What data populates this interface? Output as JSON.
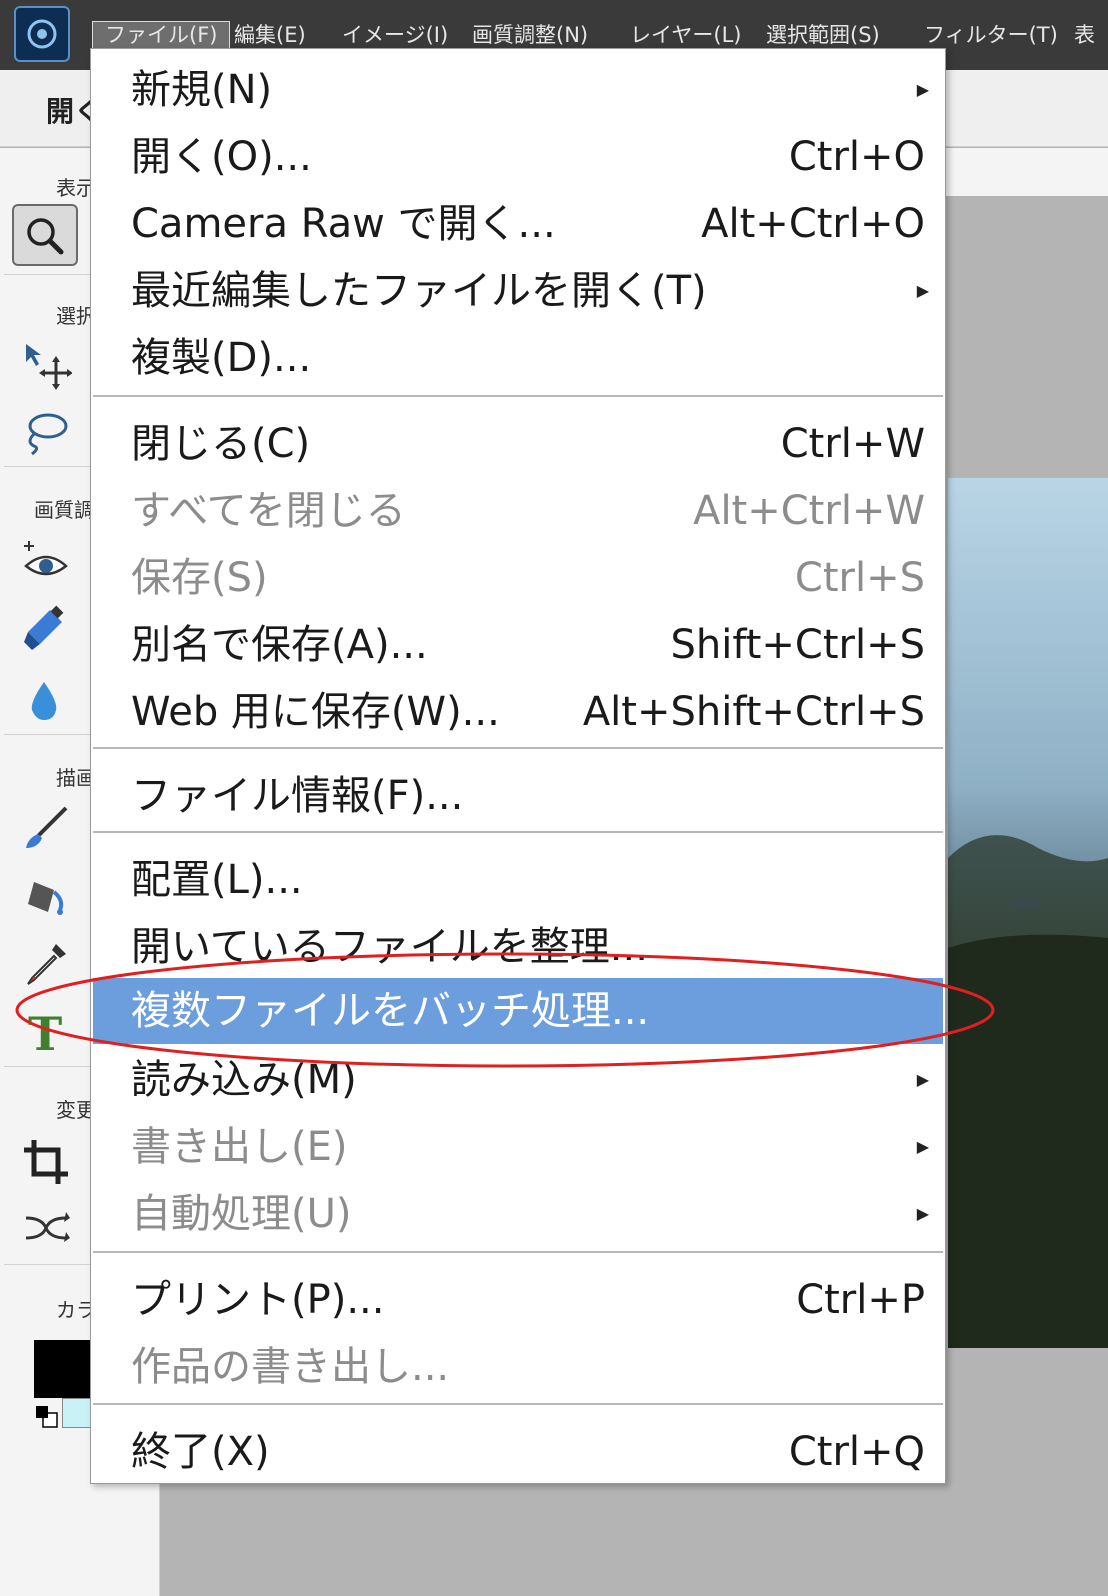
{
  "menubar": {
    "items": [
      {
        "label": "ファイル(F)"
      },
      {
        "label": "編集(E)"
      },
      {
        "label": "イメージ(I)"
      },
      {
        "label": "画質調整(N)"
      },
      {
        "label": "レイヤー(L)"
      },
      {
        "label": "選択範囲(S)"
      },
      {
        "label": "フィルター(T)"
      },
      {
        "label": "表"
      }
    ]
  },
  "options": {
    "label": "開く"
  },
  "toolpanel": {
    "sections": [
      {
        "label": "表示"
      },
      {
        "label": "選択"
      },
      {
        "label": "画質調整"
      },
      {
        "label": "描画"
      },
      {
        "label": "変更"
      },
      {
        "label": "カラー"
      }
    ]
  },
  "file_menu": {
    "items": [
      {
        "label": "新規(N)",
        "shortcut": "",
        "submenu": true,
        "disabled": false
      },
      {
        "label": "開く(O)...",
        "shortcut": "Ctrl+O",
        "submenu": false,
        "disabled": false
      },
      {
        "label": "Camera Raw で開く...",
        "shortcut": "Alt+Ctrl+O",
        "submenu": false,
        "disabled": false
      },
      {
        "label": "最近編集したファイルを開く(T)",
        "shortcut": "",
        "submenu": true,
        "disabled": false
      },
      {
        "label": "複製(D)...",
        "shortcut": "",
        "submenu": false,
        "disabled": false
      },
      {
        "label": "閉じる(C)",
        "shortcut": "Ctrl+W",
        "submenu": false,
        "disabled": false
      },
      {
        "label": "すべてを閉じる",
        "shortcut": "Alt+Ctrl+W",
        "submenu": false,
        "disabled": true
      },
      {
        "label": "保存(S)",
        "shortcut": "Ctrl+S",
        "submenu": false,
        "disabled": true
      },
      {
        "label": "別名で保存(A)...",
        "shortcut": "Shift+Ctrl+S",
        "submenu": false,
        "disabled": false
      },
      {
        "label": "Web 用に保存(W)...",
        "shortcut": "Alt+Shift+Ctrl+S",
        "submenu": false,
        "disabled": false
      },
      {
        "label": "ファイル情報(F)...",
        "shortcut": "",
        "submenu": false,
        "disabled": false
      },
      {
        "label": "配置(L)...",
        "shortcut": "",
        "submenu": false,
        "disabled": false
      },
      {
        "label": "開いているファイルを整理...",
        "shortcut": "",
        "submenu": false,
        "disabled": false
      },
      {
        "label": "複数ファイルをバッチ処理...",
        "shortcut": "",
        "submenu": false,
        "disabled": false,
        "highlighted": true
      },
      {
        "label": "読み込み(M)",
        "shortcut": "",
        "submenu": true,
        "disabled": false
      },
      {
        "label": "書き出し(E)",
        "shortcut": "",
        "submenu": true,
        "disabled": true
      },
      {
        "label": "自動処理(U)",
        "shortcut": "",
        "submenu": true,
        "disabled": true
      },
      {
        "label": "プリント(P)...",
        "shortcut": "Ctrl+P",
        "submenu": false,
        "disabled": false
      },
      {
        "label": "作品の書き出し...",
        "shortcut": "",
        "submenu": false,
        "disabled": true
      },
      {
        "label": "終了(X)",
        "shortcut": "Ctrl+Q",
        "submenu": false,
        "disabled": false
      }
    ]
  },
  "colors": {
    "menubar_bg": "#3a3a3a",
    "highlight": "#6c9ede",
    "annotation_ellipse": "#e02020",
    "foreground_swatch": "#000000",
    "background_swatch": "#c9f2f7"
  }
}
